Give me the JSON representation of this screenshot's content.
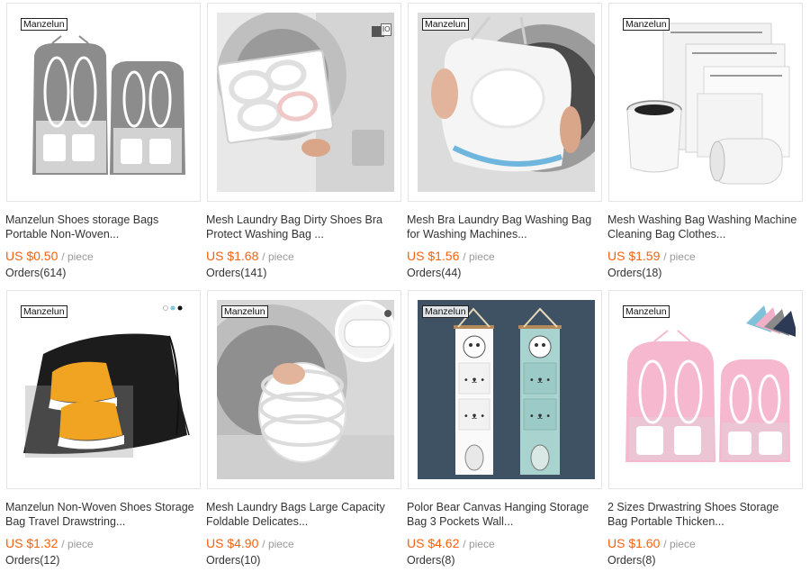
{
  "products": [
    {
      "brand": "Manzelun",
      "title": "Manzelun Shoes storage Bags Portable Non-Woven...",
      "currency": "US",
      "price": "$0.50",
      "unit": "/ piece",
      "orders": "Orders(614)"
    },
    {
      "brand": "",
      "title": "Mesh Laundry Bag Dirty Shoes Bra Protect Washing Bag ...",
      "currency": "US",
      "price": "$1.68",
      "unit": "/ piece",
      "orders": "Orders(141)",
      "washer_badge": "IO"
    },
    {
      "brand": "Manzelun",
      "title": "Mesh Bra Laundry Bag Washing Bag for Washing Machines...",
      "currency": "US",
      "price": "$1.56",
      "unit": "/ piece",
      "orders": "Orders(44)"
    },
    {
      "brand": "Manzelun",
      "title": "Mesh Washing Bag Washing Machine Cleaning Bag Clothes...",
      "currency": "US",
      "price": "$1.59",
      "unit": "/ piece",
      "orders": "Orders(18)"
    },
    {
      "brand": "Manzelun",
      "title": "Manzelun Non-Woven Shoes Storage Bag Travel Drawstring...",
      "currency": "US",
      "price": "$1.32",
      "unit": "/ piece",
      "orders": "Orders(12)"
    },
    {
      "brand": "Manzelun",
      "title": "Mesh Laundry Bags Large Capacity Foldable Delicates...",
      "currency": "US",
      "price": "$4.90",
      "unit": "/ piece",
      "orders": "Orders(10)"
    },
    {
      "brand": "Manzelun",
      "title": "Polor Bear Canvas Hanging Storage Bag 3 Pockets Wall...",
      "currency": "US",
      "price": "$4.62",
      "unit": "/ piece",
      "orders": "Orders(8)"
    },
    {
      "brand": "Manzelun",
      "title": "2 Sizes Drwastring Shoes Storage Bag Portable Thicken...",
      "currency": "US",
      "price": "$1.60",
      "unit": "/ piece",
      "orders": "Orders(8)"
    }
  ],
  "colors": {
    "price": "#f5620f",
    "unit": "#999999",
    "text": "#333333",
    "border": "#e4e4e4"
  }
}
